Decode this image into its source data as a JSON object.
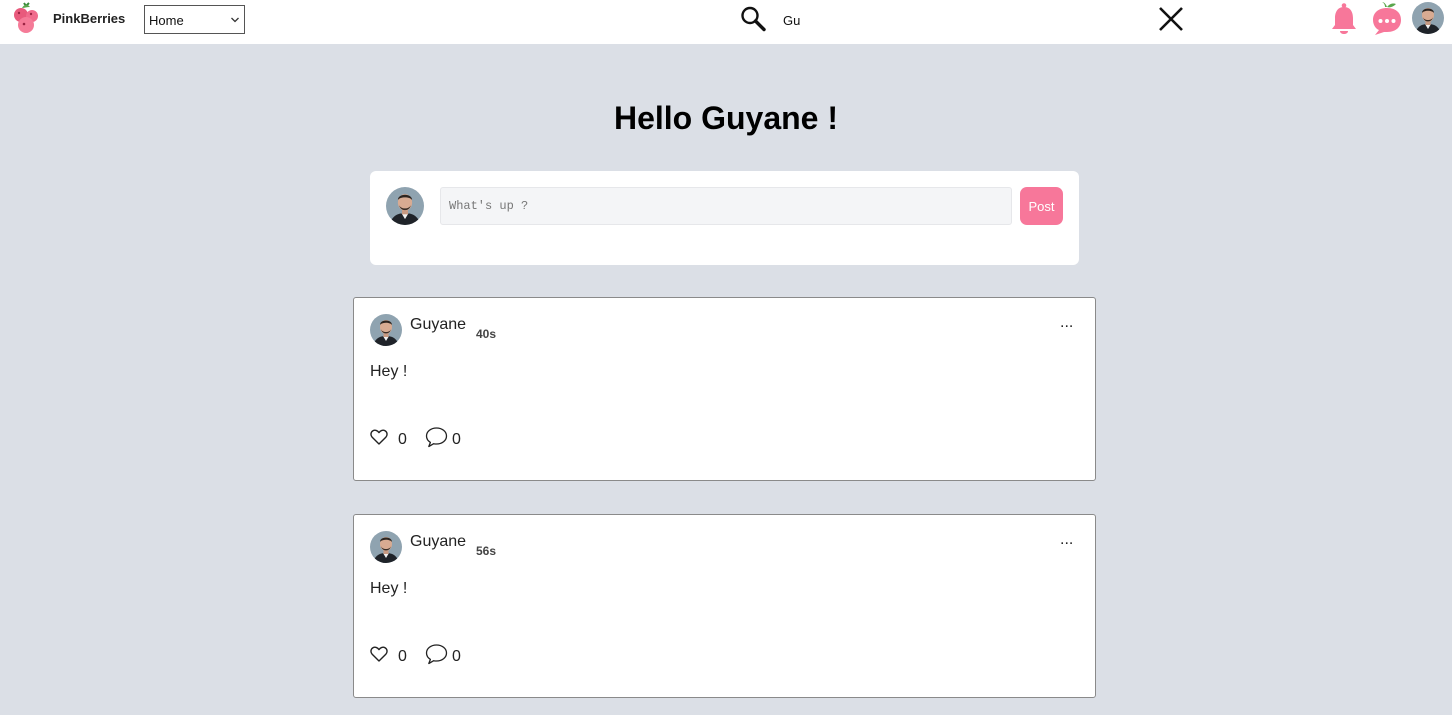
{
  "header": {
    "brand": "PinkBerries",
    "nav_select_value": "Home",
    "search_value": "Gu",
    "accent_color": "#f7779a"
  },
  "main": {
    "greeting": "Hello Guyane !",
    "composer": {
      "placeholder": "What's up ?",
      "post_label": "Post"
    },
    "posts": [
      {
        "author": "Guyane",
        "time": "40s",
        "text": "Hey !",
        "likes": "0",
        "comments": "0",
        "more": "..."
      },
      {
        "author": "Guyane",
        "time": "56s",
        "text": "Hey !",
        "likes": "0",
        "comments": "0",
        "more": "..."
      }
    ]
  }
}
